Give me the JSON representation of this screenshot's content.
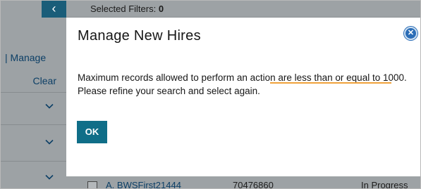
{
  "sidebar": {
    "collapse_glyph": "‹",
    "manage_label": "| Manage",
    "clear_label": "Clear",
    "chevrons": [
      "chevron-down-icon",
      "chevron-down-icon",
      "chevron-down-icon"
    ]
  },
  "toolbar": {
    "filters_label": "Selected Filters:",
    "filters_count": "0"
  },
  "modal": {
    "title": "Manage New Hires",
    "close_icon": "close-icon",
    "message_line1": "Maximum records allowed to perform an action are less than or equal to 1000.",
    "message_line2": "Please refine your search and select again.",
    "ok_label": "OK"
  },
  "table": {
    "rows": [
      {
        "name": "A. BWSFirst21444",
        "id": "70476860",
        "status": "In Progress"
      }
    ]
  },
  "colors": {
    "accent": "#0f6e88",
    "link": "#0c3f66",
    "highlight_underline": "#f0a23a",
    "overlay": "#9da2a5"
  }
}
